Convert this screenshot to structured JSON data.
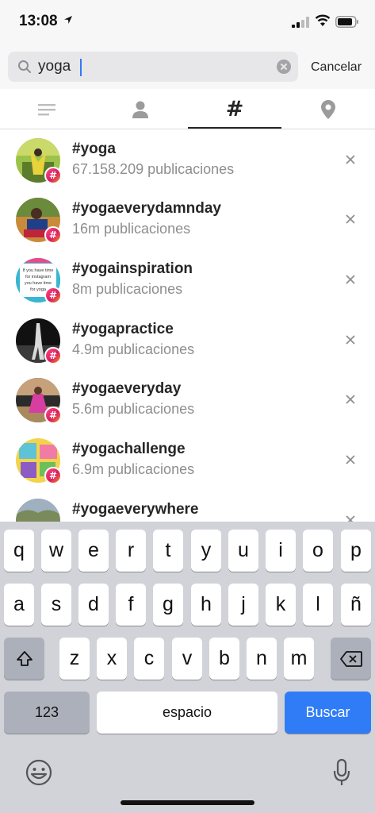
{
  "status_bar": {
    "time": "13:08"
  },
  "search": {
    "query": "yoga",
    "cancel_label": "Cancelar"
  },
  "tabs": [
    {
      "name": "top",
      "icon": "lines-icon",
      "active": false
    },
    {
      "name": "people",
      "icon": "person-icon",
      "active": false
    },
    {
      "name": "tags",
      "icon": "hashtag-icon",
      "label": "#",
      "active": true
    },
    {
      "name": "places",
      "icon": "location-pin-icon",
      "active": false
    }
  ],
  "results": [
    {
      "tag": "#yoga",
      "count": "67.158.209 publicaciones"
    },
    {
      "tag": "#yogaeverydamnday",
      "count": "16m publicaciones"
    },
    {
      "tag": "#yogainspiration",
      "count": "8m publicaciones",
      "avatar_text": [
        "If you have time",
        "for instagram",
        "you have time",
        "for yoga"
      ]
    },
    {
      "tag": "#yogapractice",
      "count": "4.9m publicaciones"
    },
    {
      "tag": "#yogaeveryday",
      "count": "5.6m publicaciones"
    },
    {
      "tag": "#yogachallenge",
      "count": "6.9m publicaciones"
    },
    {
      "tag": "#yogaeverywhere",
      "count": ""
    }
  ],
  "hashtag_badge": "#",
  "keyboard": {
    "row1": [
      "q",
      "w",
      "e",
      "r",
      "t",
      "y",
      "u",
      "i",
      "o",
      "p"
    ],
    "row2": [
      "a",
      "s",
      "d",
      "f",
      "g",
      "h",
      "j",
      "k",
      "l",
      "ñ"
    ],
    "row3": [
      "z",
      "x",
      "c",
      "v",
      "b",
      "n",
      "m"
    ],
    "numbers_label": "123",
    "space_label": "espacio",
    "search_label": "Buscar"
  },
  "colors": {
    "accent": "#2f7cf6",
    "badge": "#d91d5c",
    "secondary_text": "#8e8e8e"
  }
}
